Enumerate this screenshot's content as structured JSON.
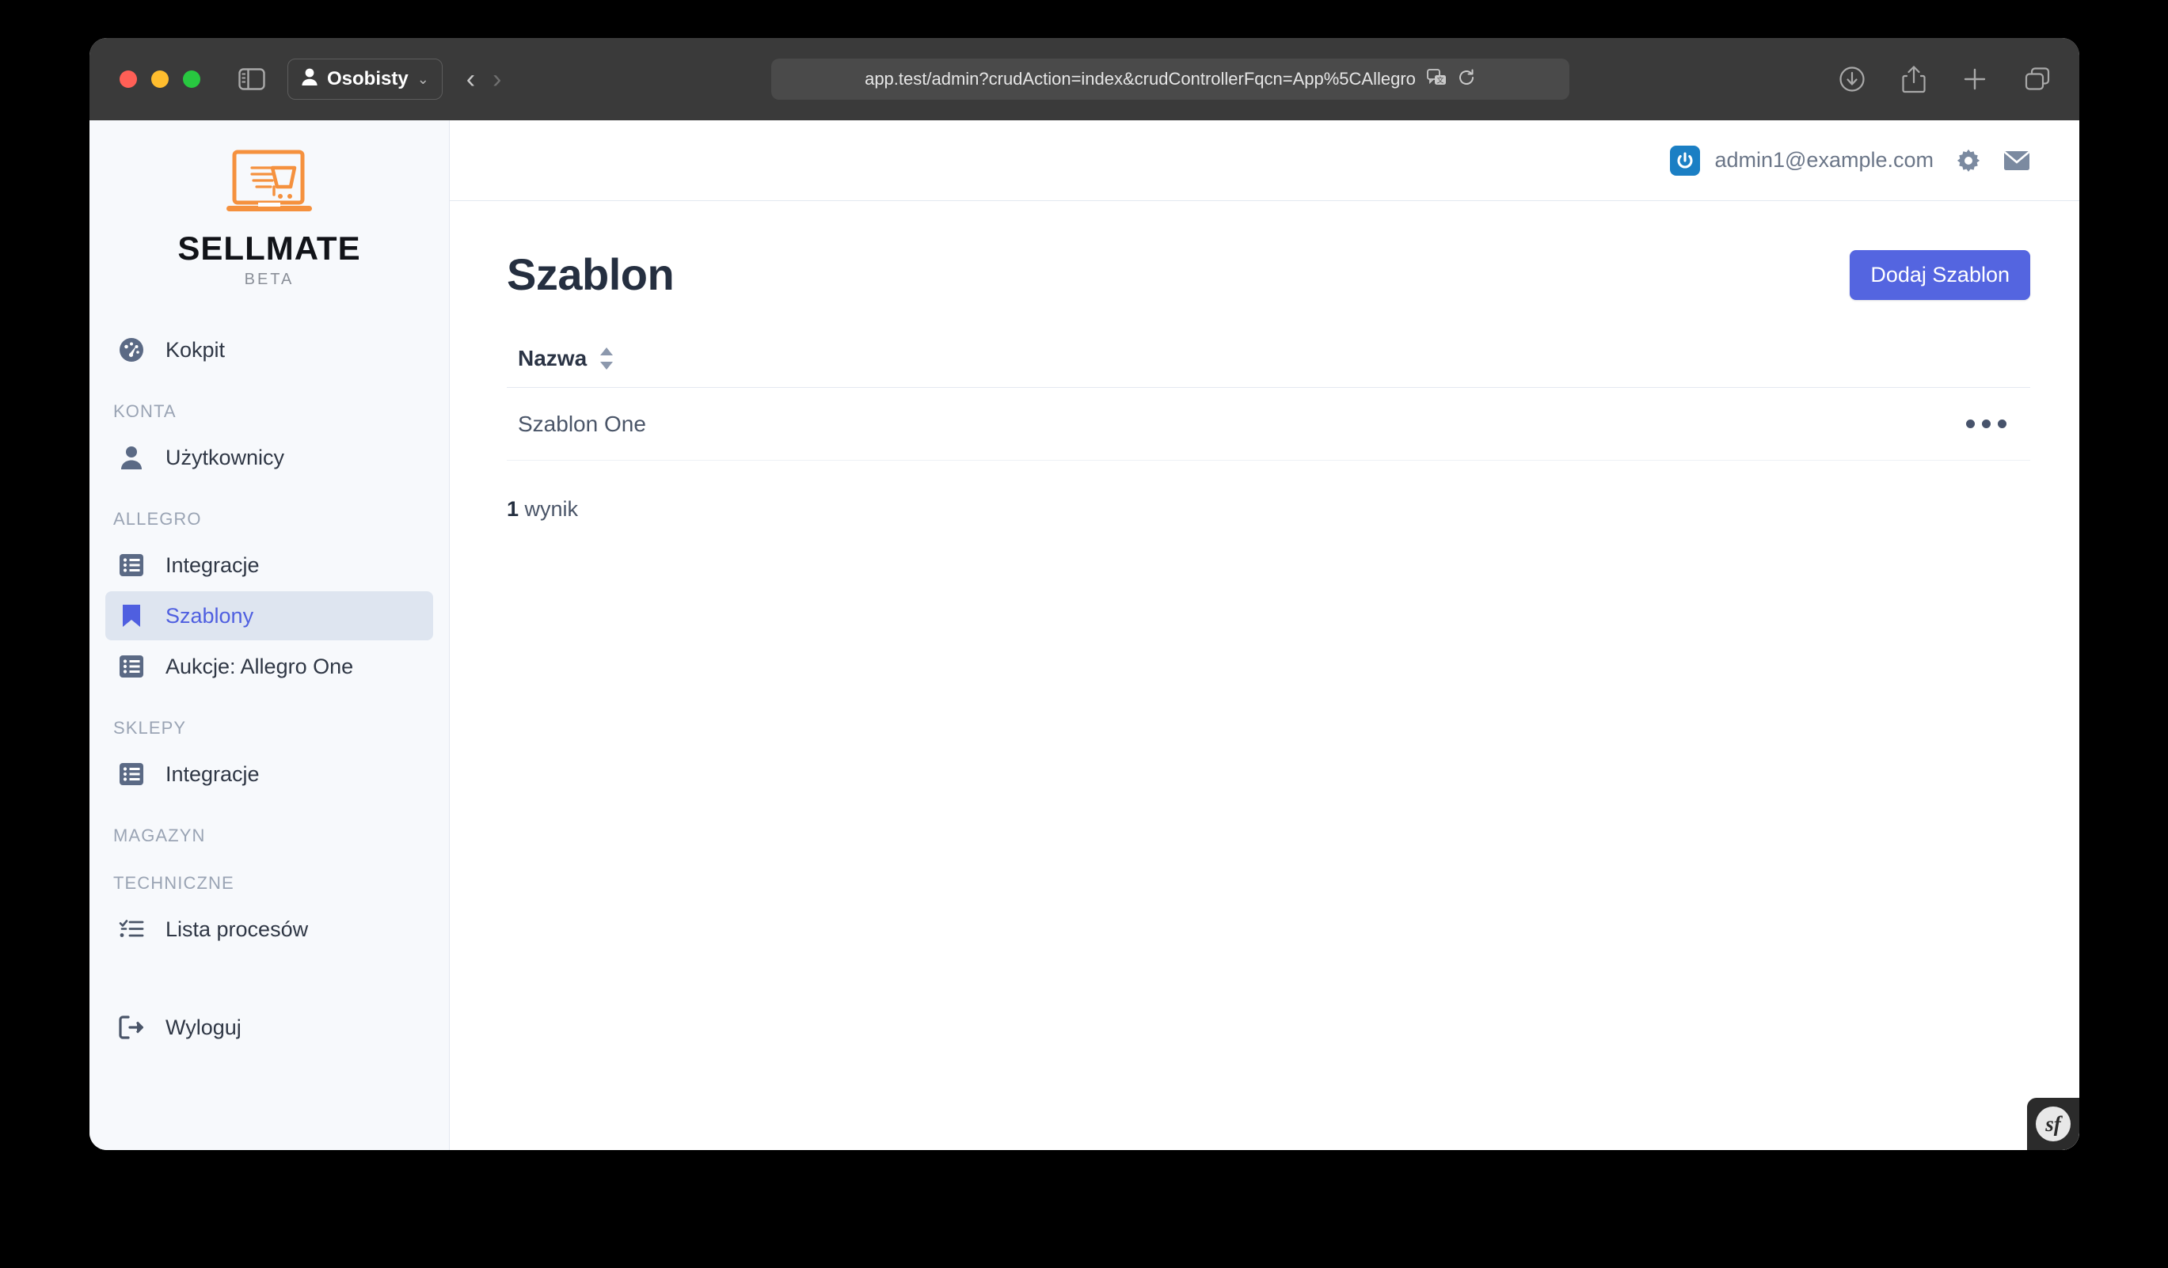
{
  "browser": {
    "profile_label": "Osobisty",
    "url": "app.test/admin?crudAction=index&crudControllerFqcn=App%5CAllegro",
    "icons": {
      "sidebar_toggle": "sidebar-toggle-icon",
      "profile": "person-icon",
      "chevron": "chevron-down-icon",
      "back": "back-arrow-icon",
      "forward": "forward-arrow-icon",
      "translate": "translate-icon",
      "reload": "reload-icon",
      "downloads": "download-icon",
      "share": "share-icon",
      "new_tab": "plus-icon",
      "tab_overview": "tabs-icon"
    },
    "back_arrow": "‹",
    "forward_arrow": "›",
    "chevron_glyph": "⌄"
  },
  "sidebar": {
    "brand": {
      "name": "SELLMATE",
      "subtitle": "BETA",
      "logo_color": "#f5913e"
    },
    "groups": [
      {
        "label": "",
        "items": [
          {
            "label": "Kokpit",
            "icon": "gauge-icon",
            "active": false
          }
        ]
      },
      {
        "label": "KONTA",
        "items": [
          {
            "label": "Użytkownicy",
            "icon": "person-icon",
            "active": false
          }
        ]
      },
      {
        "label": "ALLEGRO",
        "items": [
          {
            "label": "Integracje",
            "icon": "list-icon",
            "active": false
          },
          {
            "label": "Szablony",
            "icon": "bookmark-icon",
            "active": true
          },
          {
            "label": "Aukcje: Allegro One",
            "icon": "list-icon",
            "active": false
          }
        ]
      },
      {
        "label": "SKLEPY",
        "items": [
          {
            "label": "Integracje",
            "icon": "list-icon",
            "active": false
          }
        ]
      },
      {
        "label": "MAGAZYN",
        "items": []
      },
      {
        "label": "TECHNICZNE",
        "items": [
          {
            "label": "Lista procesów",
            "icon": "checklist-icon",
            "active": false
          }
        ]
      }
    ],
    "logout": {
      "label": "Wyloguj",
      "icon": "logout-icon"
    }
  },
  "topbar": {
    "user_email": "admin1@example.com",
    "avatar_icon": "power-icon",
    "avatar_color": "#1b7fc4",
    "settings_icon": "gear-icon",
    "mail_icon": "envelope-icon"
  },
  "main": {
    "title": "Szablon",
    "add_button": "Dodaj Szablon",
    "accent_color": "#5465e0",
    "table": {
      "columns": [
        {
          "label": "Nazwa",
          "sortable": true
        }
      ],
      "rows": [
        {
          "name": "Szablon One",
          "actions_icon": "ellipsis-icon"
        }
      ]
    },
    "results_count": "1",
    "results_label": "wynik"
  },
  "debug_toolbar": {
    "symfony_mark": "sf"
  }
}
